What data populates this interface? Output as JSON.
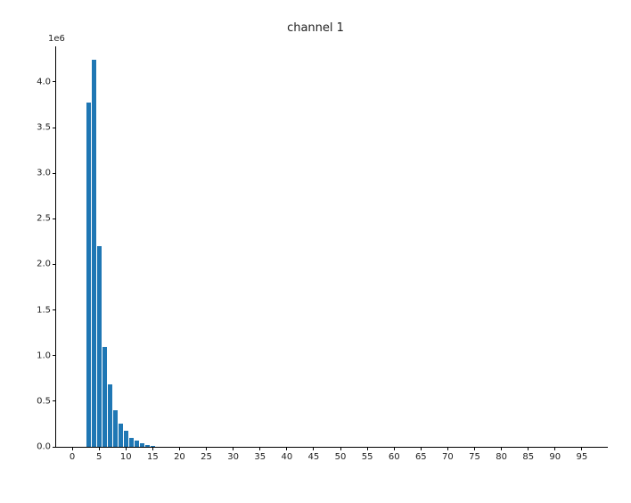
{
  "title": "channel 1",
  "y_exponent_label": "1e6",
  "x_ticks": [
    0,
    5,
    10,
    15,
    20,
    25,
    30,
    35,
    40,
    45,
    50,
    55,
    60,
    65,
    70,
    75,
    80,
    85,
    90,
    95
  ],
  "y_ticks": [
    0.0,
    0.5,
    1.0,
    1.5,
    2.0,
    2.5,
    3.0,
    3.5,
    4.0
  ],
  "chart_data": {
    "type": "bar",
    "title": "channel 1",
    "xlabel": "",
    "ylabel": "",
    "y_scale_note": "y-axis values are ×1e6",
    "xlim": [
      -3,
      100
    ],
    "ylim": [
      0,
      4.4
    ],
    "categories": [
      3,
      4,
      5,
      6,
      7,
      8,
      9,
      10,
      11,
      12,
      13,
      14,
      15
    ],
    "values": [
      3.77,
      4.24,
      2.2,
      1.1,
      0.68,
      0.4,
      0.25,
      0.18,
      0.1,
      0.07,
      0.04,
      0.02,
      0.01
    ]
  }
}
